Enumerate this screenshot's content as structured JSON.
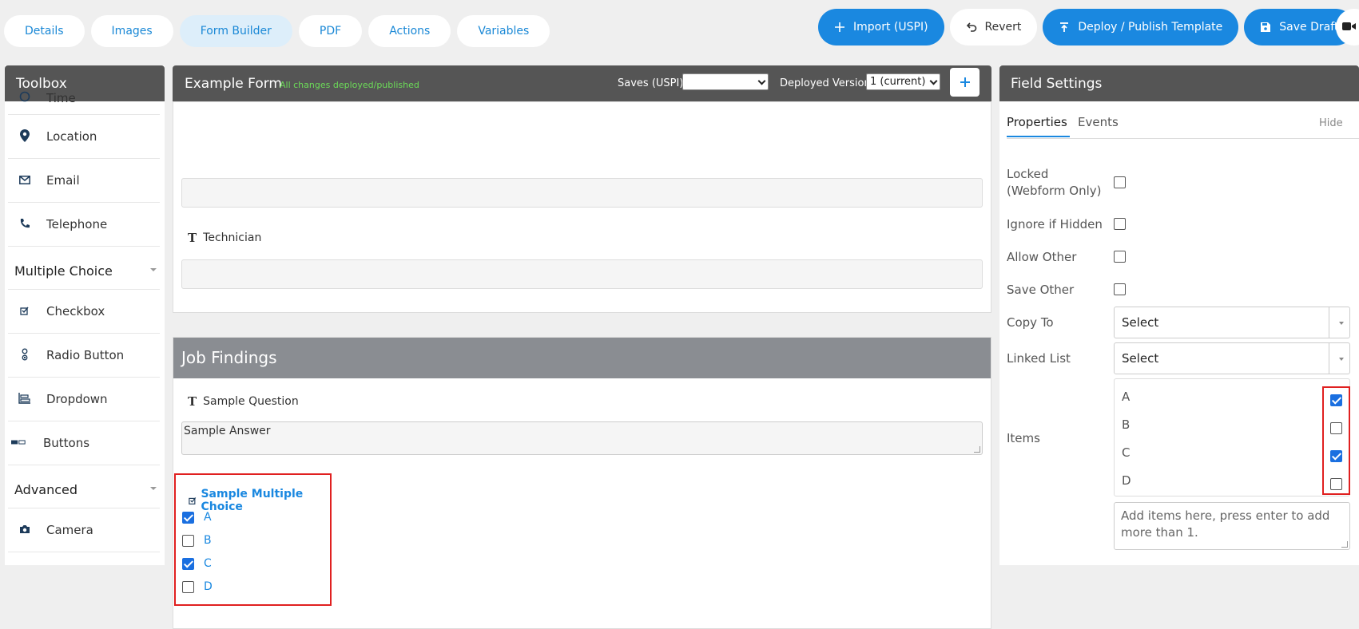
{
  "tabs": [
    {
      "label": "Details"
    },
    {
      "label": "Images"
    },
    {
      "label": "Form Builder"
    },
    {
      "label": "PDF"
    },
    {
      "label": "Actions"
    },
    {
      "label": "Variables"
    }
  ],
  "actions": {
    "import_label": "Import (USPI)",
    "revert_label": "Revert",
    "deploy_label": "Deploy / Publish Template",
    "save_draft_label": "Save Draft"
  },
  "toolbox": {
    "title": "Toolbox",
    "partial_item": "Time",
    "items_top": [
      {
        "label": "Location",
        "icon": "location-pin-icon"
      },
      {
        "label": "Email",
        "icon": "envelope-icon"
      },
      {
        "label": "Telephone",
        "icon": "phone-icon"
      }
    ],
    "cat_multiple_choice": "Multiple Choice",
    "items_mc": [
      {
        "label": "Checkbox",
        "icon": "checkbox-icon"
      },
      {
        "label": "Radio Button",
        "icon": "radio-button-icon"
      },
      {
        "label": "Dropdown",
        "icon": "dropdown-icon"
      },
      {
        "label": "Buttons",
        "icon": "buttons-icon"
      }
    ],
    "cat_advanced": "Advanced",
    "items_adv": [
      {
        "label": "Camera",
        "icon": "camera-icon"
      }
    ]
  },
  "form": {
    "title": "Example Form",
    "status": "All changes deployed/published",
    "saves_label": "Saves (USPI):",
    "saves_value": "",
    "deployed_label": "Deployed Version:",
    "deployed_value": "1 (current)",
    "technician_label": "Technician",
    "section_title": "Job Findings",
    "sample_question": "Sample Question",
    "sample_answer": "Sample Answer",
    "mc_title": "Sample Multiple Choice",
    "mc_options": [
      {
        "label": "A",
        "checked": true
      },
      {
        "label": "B",
        "checked": false
      },
      {
        "label": "C",
        "checked": true
      },
      {
        "label": "D",
        "checked": false
      }
    ]
  },
  "field_settings": {
    "title": "Field Settings",
    "tab_properties": "Properties",
    "tab_events": "Events",
    "hide_label": "Hide",
    "locked_label_1": "Locked",
    "locked_label_2": "(Webform Only)",
    "ignore_hidden_label": "Ignore if Hidden",
    "allow_other_label": "Allow Other",
    "save_other_label": "Save Other",
    "copy_to_label": "Copy To",
    "copy_to_value": "Select",
    "linked_list_label": "Linked List",
    "linked_list_value": "Select",
    "items_label": "Items",
    "items": [
      {
        "label": "A",
        "checked": true
      },
      {
        "label": "B",
        "checked": false
      },
      {
        "label": "C",
        "checked": true
      },
      {
        "label": "D",
        "checked": false
      }
    ],
    "add_items_placeholder": "Add items here, press enter to add more than 1."
  },
  "colors": {
    "accent": "#1a88e0",
    "header": "#555555",
    "section_header": "#8a8d92",
    "highlight": "#e02020",
    "status_green": "#6cdc58"
  }
}
